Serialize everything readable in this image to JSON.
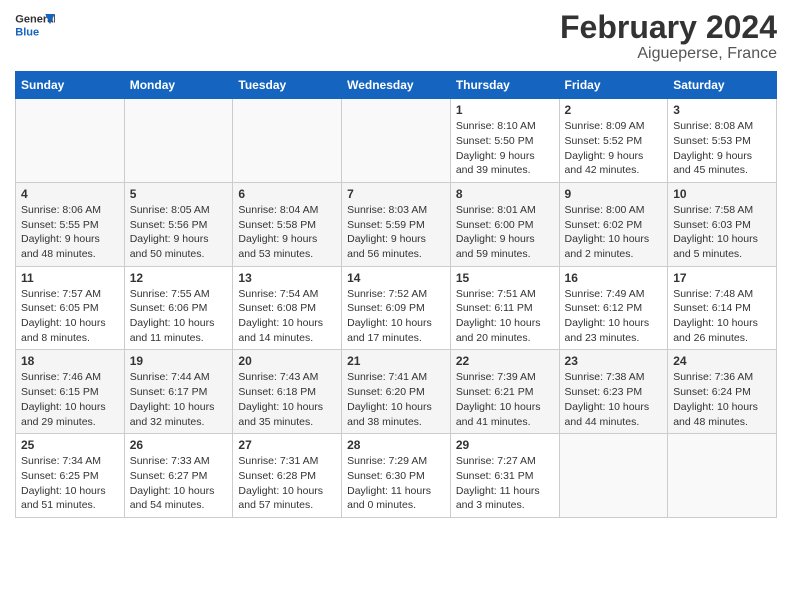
{
  "logo": {
    "general": "General",
    "blue": "Blue"
  },
  "title": "February 2024",
  "subtitle": "Aigueperse, France",
  "days_header": [
    "Sunday",
    "Monday",
    "Tuesday",
    "Wednesday",
    "Thursday",
    "Friday",
    "Saturday"
  ],
  "weeks": [
    [
      {
        "num": "",
        "info": ""
      },
      {
        "num": "",
        "info": ""
      },
      {
        "num": "",
        "info": ""
      },
      {
        "num": "",
        "info": ""
      },
      {
        "num": "1",
        "info": "Sunrise: 8:10 AM\nSunset: 5:50 PM\nDaylight: 9 hours\nand 39 minutes."
      },
      {
        "num": "2",
        "info": "Sunrise: 8:09 AM\nSunset: 5:52 PM\nDaylight: 9 hours\nand 42 minutes."
      },
      {
        "num": "3",
        "info": "Sunrise: 8:08 AM\nSunset: 5:53 PM\nDaylight: 9 hours\nand 45 minutes."
      }
    ],
    [
      {
        "num": "4",
        "info": "Sunrise: 8:06 AM\nSunset: 5:55 PM\nDaylight: 9 hours\nand 48 minutes."
      },
      {
        "num": "5",
        "info": "Sunrise: 8:05 AM\nSunset: 5:56 PM\nDaylight: 9 hours\nand 50 minutes."
      },
      {
        "num": "6",
        "info": "Sunrise: 8:04 AM\nSunset: 5:58 PM\nDaylight: 9 hours\nand 53 minutes."
      },
      {
        "num": "7",
        "info": "Sunrise: 8:03 AM\nSunset: 5:59 PM\nDaylight: 9 hours\nand 56 minutes."
      },
      {
        "num": "8",
        "info": "Sunrise: 8:01 AM\nSunset: 6:00 PM\nDaylight: 9 hours\nand 59 minutes."
      },
      {
        "num": "9",
        "info": "Sunrise: 8:00 AM\nSunset: 6:02 PM\nDaylight: 10 hours\nand 2 minutes."
      },
      {
        "num": "10",
        "info": "Sunrise: 7:58 AM\nSunset: 6:03 PM\nDaylight: 10 hours\nand 5 minutes."
      }
    ],
    [
      {
        "num": "11",
        "info": "Sunrise: 7:57 AM\nSunset: 6:05 PM\nDaylight: 10 hours\nand 8 minutes."
      },
      {
        "num": "12",
        "info": "Sunrise: 7:55 AM\nSunset: 6:06 PM\nDaylight: 10 hours\nand 11 minutes."
      },
      {
        "num": "13",
        "info": "Sunrise: 7:54 AM\nSunset: 6:08 PM\nDaylight: 10 hours\nand 14 minutes."
      },
      {
        "num": "14",
        "info": "Sunrise: 7:52 AM\nSunset: 6:09 PM\nDaylight: 10 hours\nand 17 minutes."
      },
      {
        "num": "15",
        "info": "Sunrise: 7:51 AM\nSunset: 6:11 PM\nDaylight: 10 hours\nand 20 minutes."
      },
      {
        "num": "16",
        "info": "Sunrise: 7:49 AM\nSunset: 6:12 PM\nDaylight: 10 hours\nand 23 minutes."
      },
      {
        "num": "17",
        "info": "Sunrise: 7:48 AM\nSunset: 6:14 PM\nDaylight: 10 hours\nand 26 minutes."
      }
    ],
    [
      {
        "num": "18",
        "info": "Sunrise: 7:46 AM\nSunset: 6:15 PM\nDaylight: 10 hours\nand 29 minutes."
      },
      {
        "num": "19",
        "info": "Sunrise: 7:44 AM\nSunset: 6:17 PM\nDaylight: 10 hours\nand 32 minutes."
      },
      {
        "num": "20",
        "info": "Sunrise: 7:43 AM\nSunset: 6:18 PM\nDaylight: 10 hours\nand 35 minutes."
      },
      {
        "num": "21",
        "info": "Sunrise: 7:41 AM\nSunset: 6:20 PM\nDaylight: 10 hours\nand 38 minutes."
      },
      {
        "num": "22",
        "info": "Sunrise: 7:39 AM\nSunset: 6:21 PM\nDaylight: 10 hours\nand 41 minutes."
      },
      {
        "num": "23",
        "info": "Sunrise: 7:38 AM\nSunset: 6:23 PM\nDaylight: 10 hours\nand 44 minutes."
      },
      {
        "num": "24",
        "info": "Sunrise: 7:36 AM\nSunset: 6:24 PM\nDaylight: 10 hours\nand 48 minutes."
      }
    ],
    [
      {
        "num": "25",
        "info": "Sunrise: 7:34 AM\nSunset: 6:25 PM\nDaylight: 10 hours\nand 51 minutes."
      },
      {
        "num": "26",
        "info": "Sunrise: 7:33 AM\nSunset: 6:27 PM\nDaylight: 10 hours\nand 54 minutes."
      },
      {
        "num": "27",
        "info": "Sunrise: 7:31 AM\nSunset: 6:28 PM\nDaylight: 10 hours\nand 57 minutes."
      },
      {
        "num": "28",
        "info": "Sunrise: 7:29 AM\nSunset: 6:30 PM\nDaylight: 11 hours\nand 0 minutes."
      },
      {
        "num": "29",
        "info": "Sunrise: 7:27 AM\nSunset: 6:31 PM\nDaylight: 11 hours\nand 3 minutes."
      },
      {
        "num": "",
        "info": ""
      },
      {
        "num": "",
        "info": ""
      }
    ]
  ]
}
